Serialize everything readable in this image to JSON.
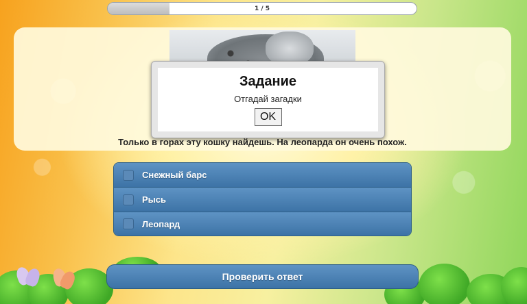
{
  "progress": {
    "label": "1 / 5",
    "current": 1,
    "total": 5,
    "fraction": 0.2
  },
  "question": {
    "text": "Только в горах эту кошку найдешь. На леопарда он очень похож."
  },
  "dialog": {
    "title": "Задание",
    "message": "Отгадай загадки",
    "ok_label": "OK"
  },
  "options": [
    {
      "label": "Снежный барс",
      "checked": false
    },
    {
      "label": "Рысь",
      "checked": false
    },
    {
      "label": "Леопард",
      "checked": false
    }
  ],
  "check_button": {
    "label": "Проверить ответ"
  },
  "colors": {
    "accent": "#4a80b4",
    "card": "#fffadc"
  }
}
